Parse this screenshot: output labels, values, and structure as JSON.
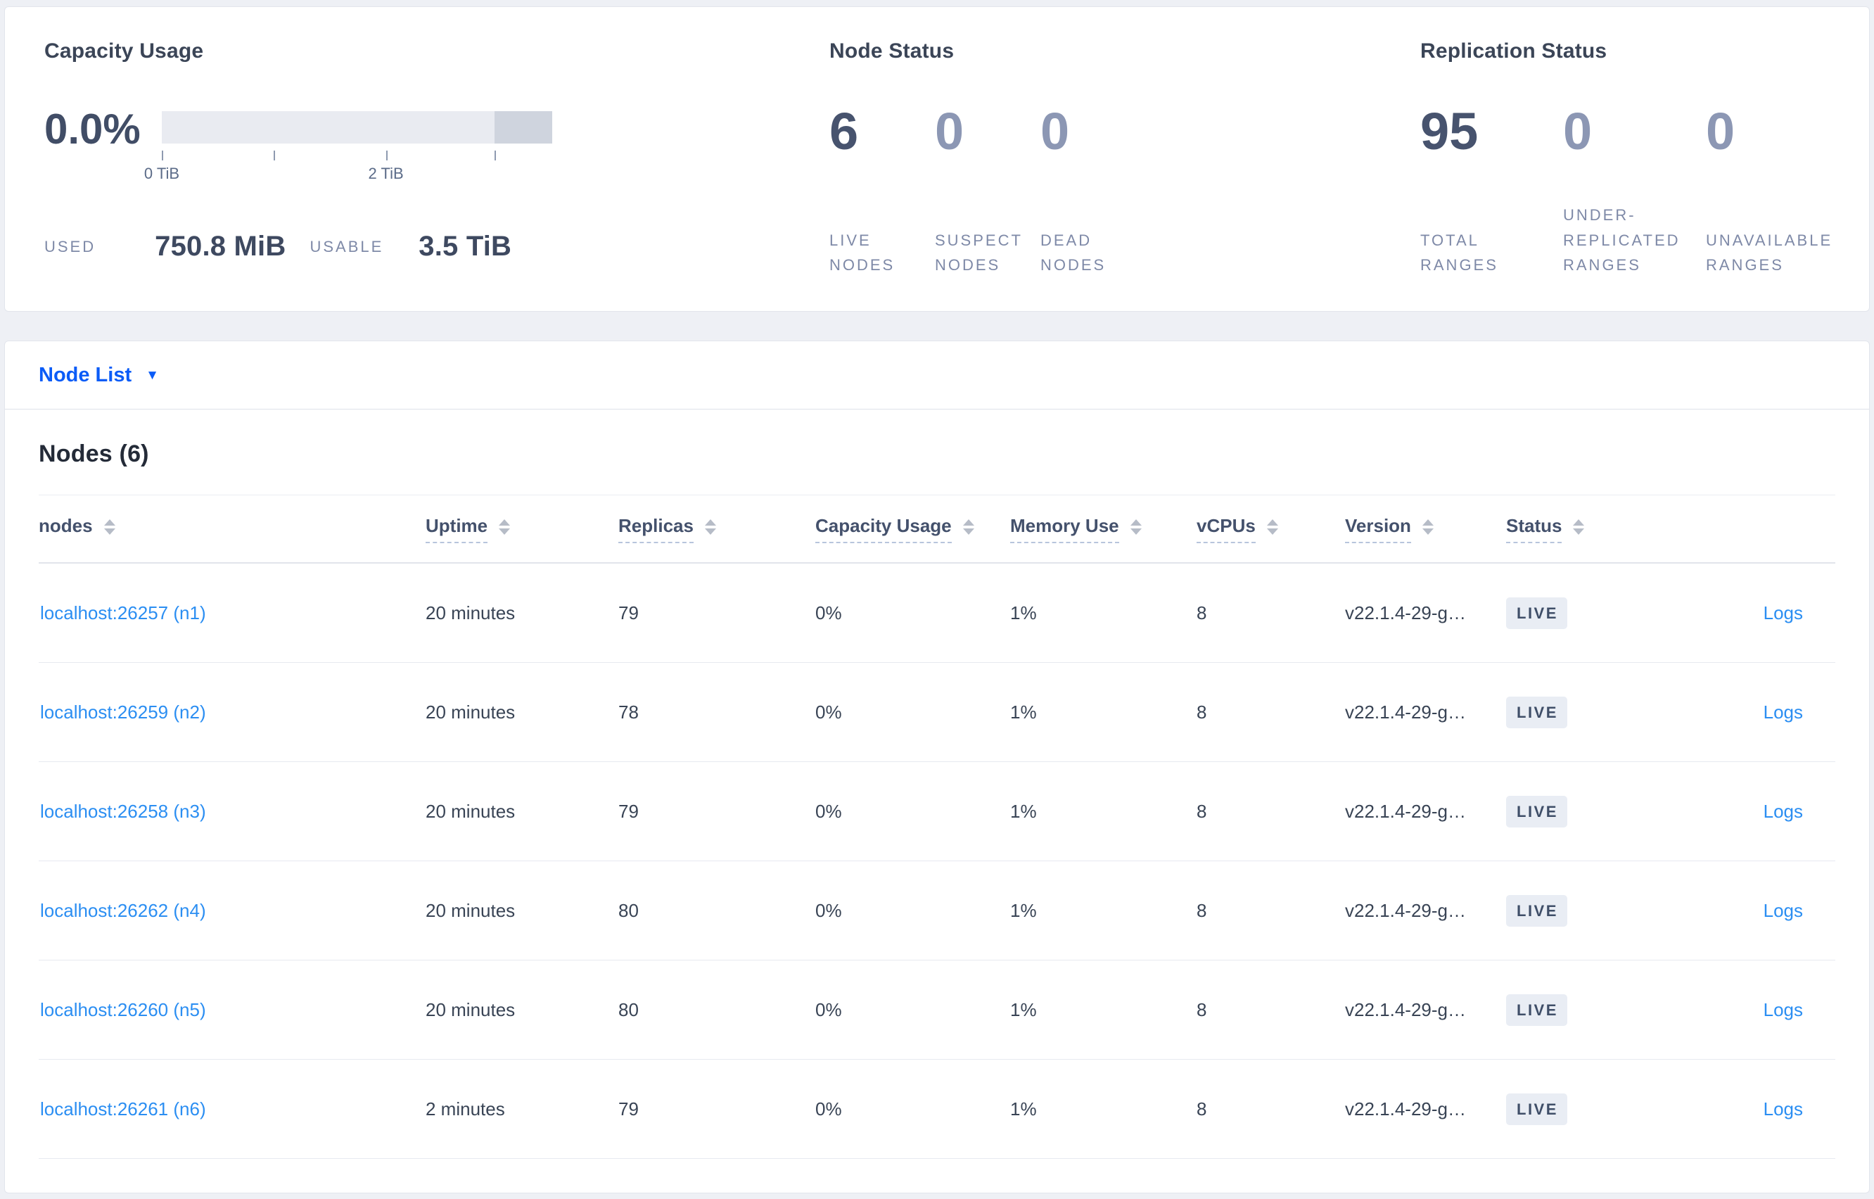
{
  "overview": {
    "capacity": {
      "title": "Capacity Usage",
      "percent": "0.0%",
      "tick_labels": [
        "0 TiB",
        "2 TiB"
      ],
      "used_label": "USED",
      "used_value": "750.8 MiB",
      "usable_label": "USABLE",
      "usable_value": "3.5 TiB"
    },
    "node_status": {
      "title": "Node Status",
      "stats": [
        {
          "value": "6",
          "label": "LIVE NODES"
        },
        {
          "value": "0",
          "label": "SUSPECT NODES"
        },
        {
          "value": "0",
          "label": "DEAD NODES"
        }
      ]
    },
    "replication": {
      "title": "Replication Status",
      "stats": [
        {
          "value": "95",
          "label": "TOTAL RANGES"
        },
        {
          "value": "0",
          "label": "UNDER-REPLICATED RANGES"
        },
        {
          "value": "0",
          "label": "UNAVAILABLE RANGES"
        }
      ]
    }
  },
  "node_list": {
    "dropdown_label": "Node List",
    "caret": "▼",
    "section_title": "Nodes (6)",
    "columns": {
      "nodes": "nodes",
      "uptime": "Uptime",
      "replicas": "Replicas",
      "capacity": "Capacity Usage",
      "memory": "Memory Use",
      "vcpus": "vCPUs",
      "version": "Version",
      "status": "Status"
    },
    "rows": [
      {
        "node": "localhost:26257 (n1)",
        "uptime": "20 minutes",
        "replicas": "79",
        "capacity": "0%",
        "memory": "1%",
        "vcpus": "8",
        "version": "v22.1.4-29-g…",
        "status": "LIVE",
        "logs": "Logs"
      },
      {
        "node": "localhost:26259 (n2)",
        "uptime": "20 minutes",
        "replicas": "78",
        "capacity": "0%",
        "memory": "1%",
        "vcpus": "8",
        "version": "v22.1.4-29-g…",
        "status": "LIVE",
        "logs": "Logs"
      },
      {
        "node": "localhost:26258 (n3)",
        "uptime": "20 minutes",
        "replicas": "79",
        "capacity": "0%",
        "memory": "1%",
        "vcpus": "8",
        "version": "v22.1.4-29-g…",
        "status": "LIVE",
        "logs": "Logs"
      },
      {
        "node": "localhost:26262 (n4)",
        "uptime": "20 minutes",
        "replicas": "80",
        "capacity": "0%",
        "memory": "1%",
        "vcpus": "8",
        "version": "v22.1.4-29-g…",
        "status": "LIVE",
        "logs": "Logs"
      },
      {
        "node": "localhost:26260 (n5)",
        "uptime": "20 minutes",
        "replicas": "80",
        "capacity": "0%",
        "memory": "1%",
        "vcpus": "8",
        "version": "v22.1.4-29-g…",
        "status": "LIVE",
        "logs": "Logs"
      },
      {
        "node": "localhost:26261 (n6)",
        "uptime": "2 minutes",
        "replicas": "79",
        "capacity": "0%",
        "memory": "1%",
        "vcpus": "8",
        "version": "v22.1.4-29-g…",
        "status": "LIVE",
        "logs": "Logs"
      }
    ]
  },
  "colors": {
    "accent_blue": "#0b5cf7",
    "link_blue": "#2b8ef2",
    "stat_dark": "#47536e",
    "stat_muted": "#8c97b4",
    "badge_bg": "#e9edf4"
  },
  "capacity_bar": {
    "used_fraction": 0,
    "dark_segment_start_fraction": 0.853,
    "tick_fractions": [
      0,
      0.287,
      0.574,
      0.853
    ]
  }
}
